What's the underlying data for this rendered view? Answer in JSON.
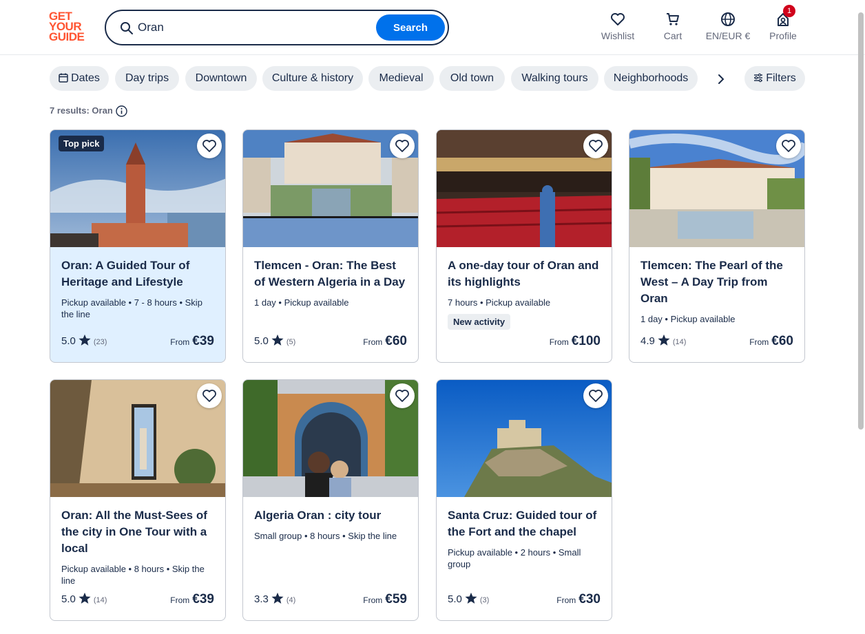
{
  "header": {
    "logo": [
      "GET",
      "YOUR",
      "GUIDE"
    ],
    "search_value": "Oran",
    "search_button": "Search",
    "nav": [
      {
        "label": "Wishlist",
        "icon": "heart-icon"
      },
      {
        "label": "Cart",
        "icon": "cart-icon"
      },
      {
        "label": "EN/EUR €",
        "icon": "globe-icon"
      },
      {
        "label": "Profile",
        "icon": "profile-icon",
        "badge": "1"
      }
    ]
  },
  "chips": [
    {
      "label": "Dates",
      "icon": "calendar-icon"
    },
    {
      "label": "Day trips"
    },
    {
      "label": "Downtown"
    },
    {
      "label": "Culture & history"
    },
    {
      "label": "Medieval"
    },
    {
      "label": "Old town"
    },
    {
      "label": "Walking tours"
    },
    {
      "label": "Neighborhoods"
    }
  ],
  "filters_label": "Filters",
  "results_text": "7 results: Oran",
  "cards": [
    {
      "title": "Oran: A Guided Tour of Heritage and Lifestyle",
      "meta": "Pickup available • 7 - 8 hours • Skip the line",
      "badge": "Top pick",
      "rating": "5.0",
      "count": "(23)",
      "from": "From",
      "price": "€39"
    },
    {
      "title": "Tlemcen - Oran: The Best of Western Algeria in a Day",
      "meta": "1 day • Pickup available",
      "rating": "5.0",
      "count": "(5)",
      "from": "From",
      "price": "€60"
    },
    {
      "title": "A one-day tour of Oran and its highlights",
      "meta": "7 hours • Pickup available",
      "tag": "New activity",
      "from": "From",
      "price": "€100"
    },
    {
      "title": "Tlemcen: The Pearl of the West – A Day Trip from Oran",
      "meta": "1 day • Pickup available",
      "rating": "4.9",
      "count": "(14)",
      "from": "From",
      "price": "€60"
    },
    {
      "title": "Oran: All the Must-Sees of the city in One Tour with a local",
      "meta": "Pickup available • 8 hours • Skip the line",
      "rating": "5.0",
      "count": "(14)",
      "from": "From",
      "price": "€39"
    },
    {
      "title": "Algeria Oran : city tour",
      "meta": "Small group • 8 hours • Skip the line",
      "rating": "3.3",
      "count": "(4)",
      "from": "From",
      "price": "€59"
    },
    {
      "title": "Santa Cruz: Guided tour of the Fort and the chapel",
      "meta": "Pickup available • 2 hours • Small group",
      "rating": "5.0",
      "count": "(3)",
      "from": "From",
      "price": "€30"
    }
  ],
  "colors": {
    "brand": "#ff5533",
    "accent": "#0071eb",
    "text": "#1a2b49",
    "highlight": "#e0f0ff"
  }
}
